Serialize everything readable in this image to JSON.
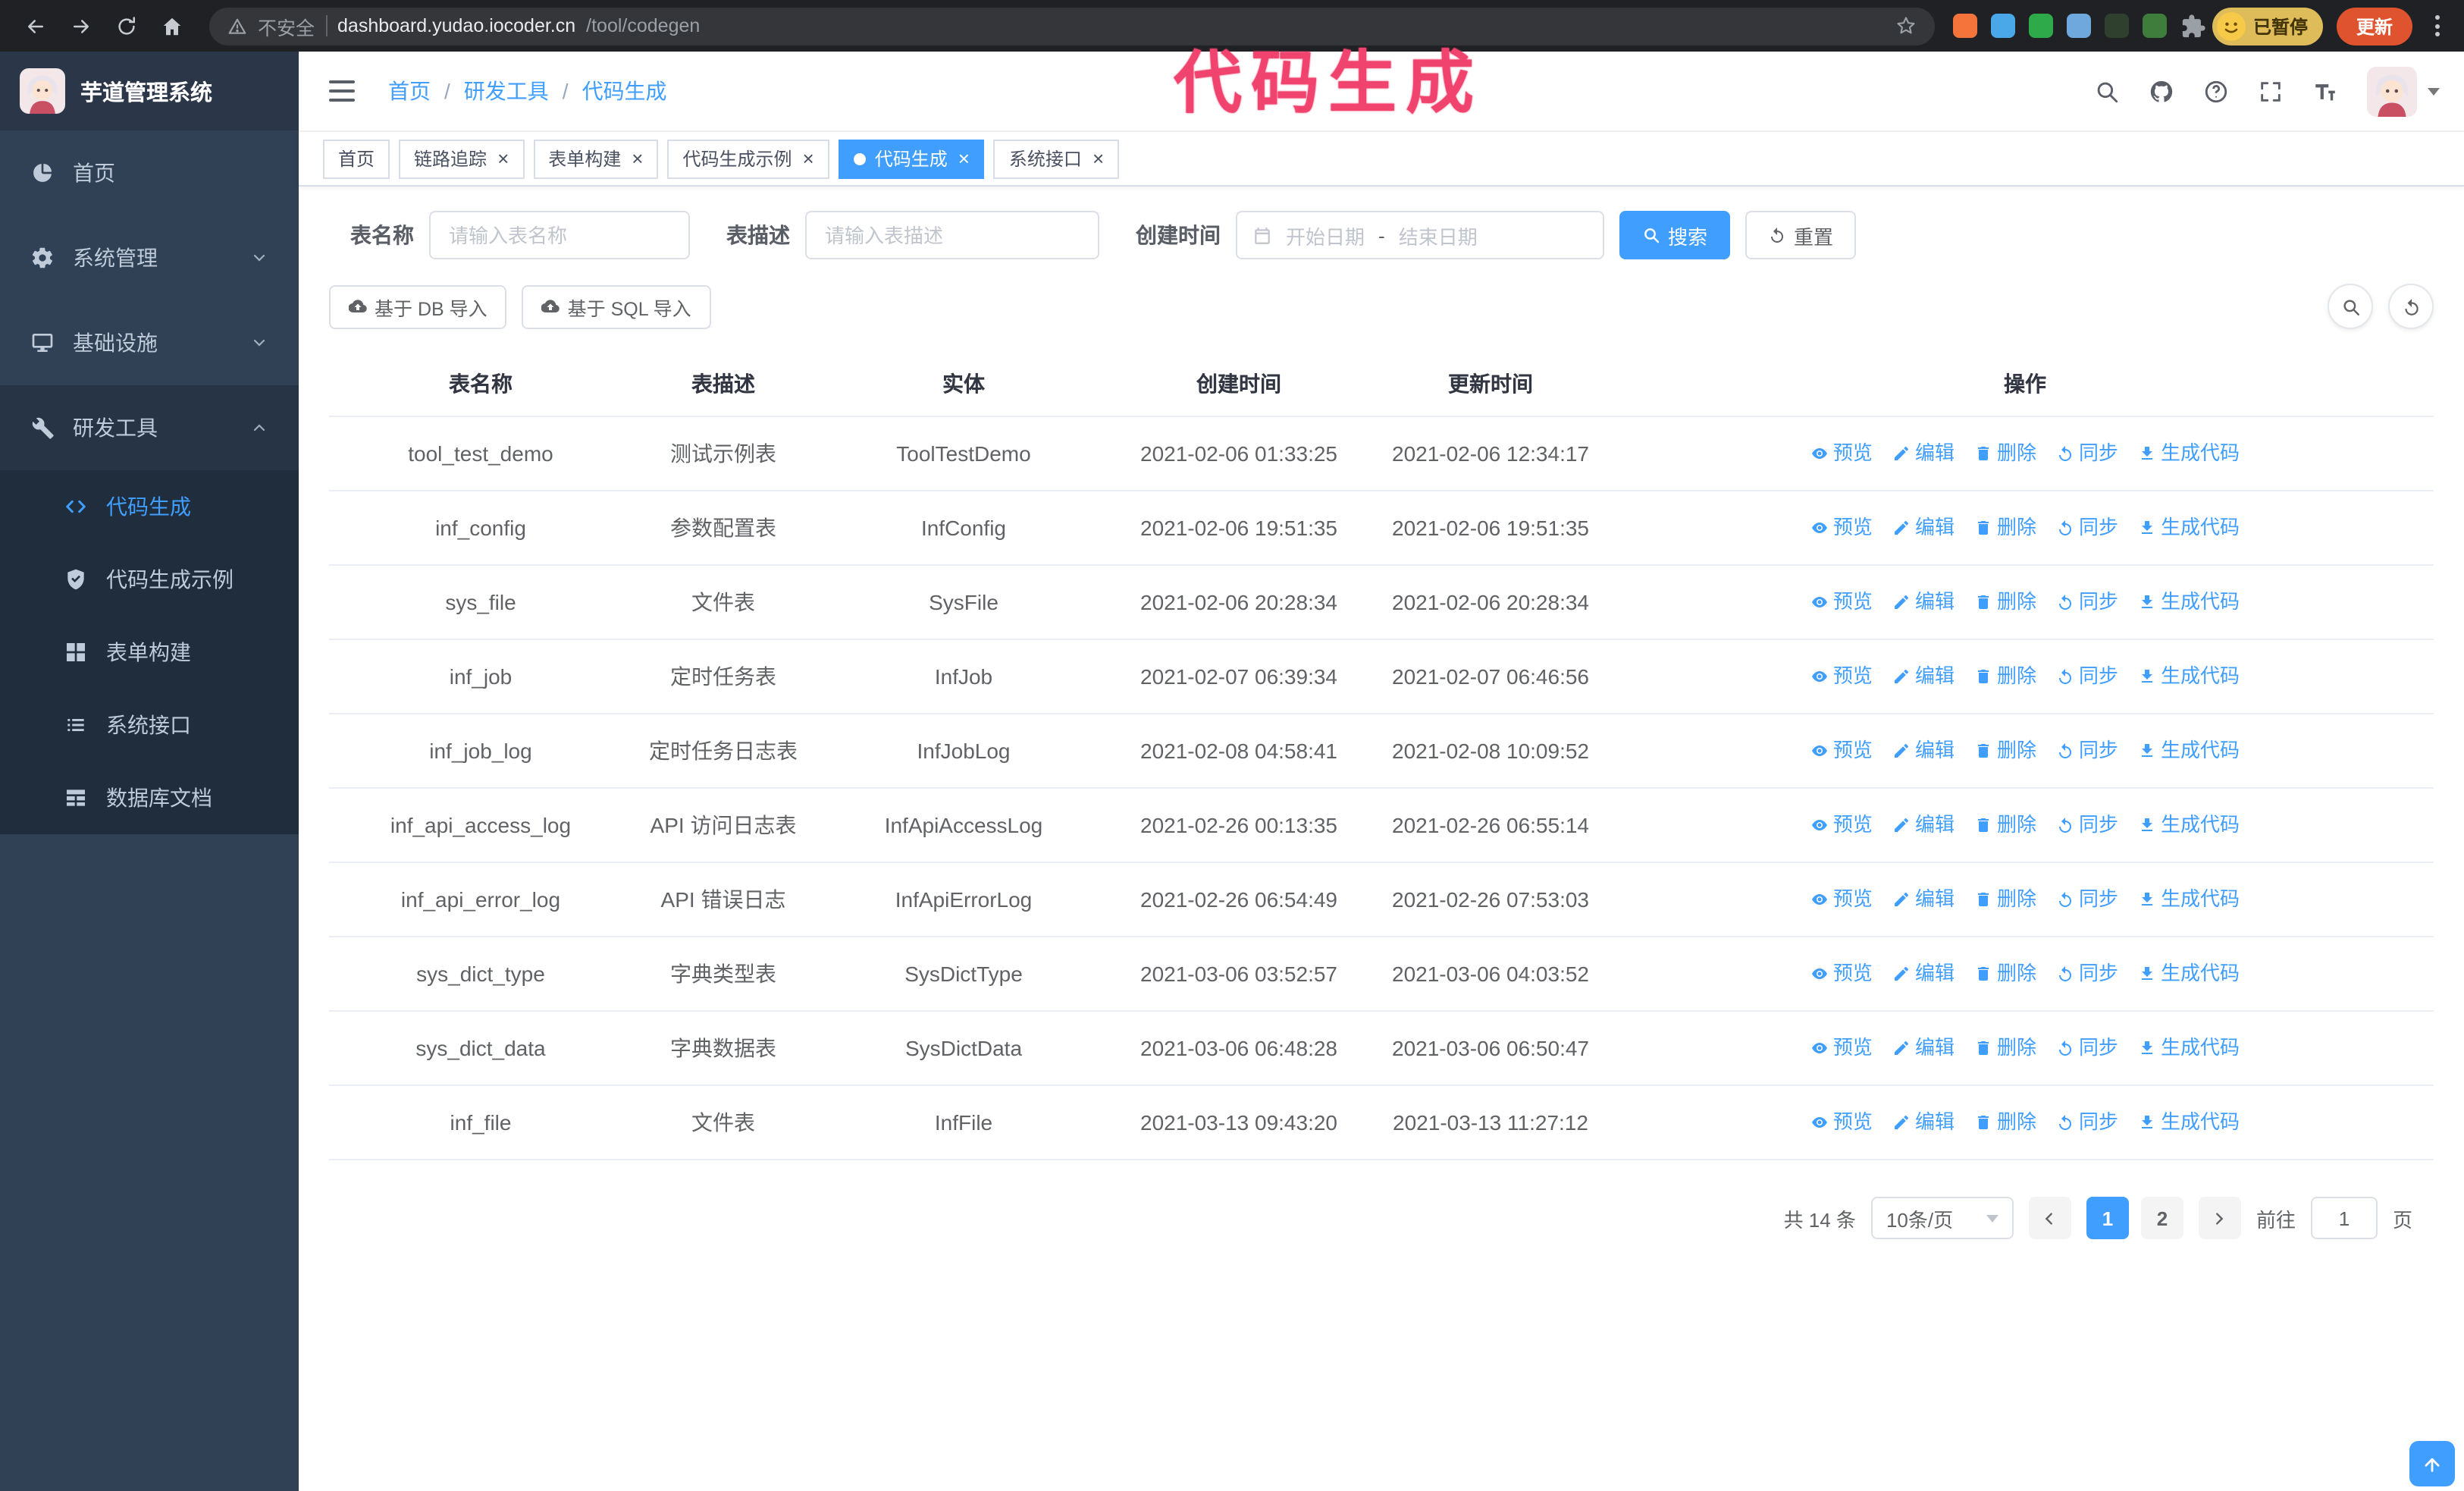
{
  "colors": {
    "primary": "#409eff",
    "annotation_pink": "#f0436e",
    "chrome_bg": "#202124",
    "sidebar_bg": "#304156",
    "submenu_bg": "#1f2d3d",
    "update_button_bg": "#e0532f"
  },
  "browser": {
    "security_label": "不安全",
    "url_host": "dashboard.yudao.iocoder.cn",
    "url_path": "/tool/codegen",
    "paused_badge": "已暂停",
    "update_button": "更新",
    "extensions": [
      {
        "icon": "orange-extension-icon",
        "color": "#f4743b"
      },
      {
        "icon": "blue-droplet-extension-icon",
        "color": "#4aa8e8"
      },
      {
        "icon": "green-circle-extension-icon",
        "color": "#2faa4a"
      },
      {
        "icon": "people-extension-icon",
        "color": "#6fa8dc"
      },
      {
        "icon": "dark-leaf-extension-icon",
        "color": "#30402f"
      },
      {
        "icon": "green-plant-extension-icon",
        "color": "#3e7d3b"
      },
      {
        "icon": "puzzle-extension-icon",
        "color": "#9aa0a6"
      }
    ]
  },
  "annotation": {
    "text": "代码生成"
  },
  "sidebar": {
    "logo_title": "芋道管理系统",
    "items": [
      {
        "key": "home",
        "label": "首页",
        "icon": "dashboard-icon",
        "expandable": false,
        "state": "none"
      },
      {
        "key": "system",
        "label": "系统管理",
        "icon": "gear-icon",
        "expandable": true,
        "state": "collapsed"
      },
      {
        "key": "infra",
        "label": "基础设施",
        "icon": "infra-icon",
        "expandable": true,
        "state": "collapsed"
      },
      {
        "key": "devtools",
        "label": "研发工具",
        "icon": "tools-icon",
        "expandable": true,
        "state": "expanded"
      }
    ],
    "submenu": [
      {
        "key": "codegen",
        "label": "代码生成",
        "icon": "code-icon",
        "active": true
      },
      {
        "key": "codegen-example",
        "label": "代码生成示例",
        "icon": "example-icon",
        "active": false
      },
      {
        "key": "form-builder",
        "label": "表单构建",
        "icon": "form-icon",
        "active": false
      },
      {
        "key": "system-api",
        "label": "系统接口",
        "icon": "api-icon",
        "active": false
      },
      {
        "key": "db-doc",
        "label": "数据库文档",
        "icon": "db-doc-icon",
        "active": false
      }
    ]
  },
  "navbar": {
    "breadcrumb": [
      "首页",
      "研发工具",
      "代码生成"
    ]
  },
  "tabs": [
    {
      "key": "home",
      "label": "首页",
      "closable": false,
      "active": false
    },
    {
      "key": "tracer",
      "label": "链路追踪",
      "closable": true,
      "active": false
    },
    {
      "key": "form-builder",
      "label": "表单构建",
      "closable": true,
      "active": false
    },
    {
      "key": "codegen-example",
      "label": "代码生成示例",
      "closable": true,
      "active": false
    },
    {
      "key": "codegen",
      "label": "代码生成",
      "closable": true,
      "active": true
    },
    {
      "key": "system-api",
      "label": "系统接口",
      "closable": true,
      "active": false
    }
  ],
  "filters": {
    "table_name_label": "表名称",
    "table_name_placeholder": "请输入表名称",
    "table_desc_label": "表描述",
    "table_desc_placeholder": "请输入表描述",
    "create_time_label": "创建时间",
    "date_start_placeholder": "开始日期",
    "date_separator": "-",
    "date_end_placeholder": "结束日期",
    "search_button": "搜索",
    "reset_button": "重置"
  },
  "toolbar": {
    "import_db_button": "基于 DB 导入",
    "import_sql_button": "基于 SQL 导入"
  },
  "table": {
    "columns": [
      "表名称",
      "表描述",
      "实体",
      "创建时间",
      "更新时间",
      "操作"
    ],
    "actions": [
      {
        "key": "preview",
        "label": "预览",
        "icon": "eye-icon"
      },
      {
        "key": "edit",
        "label": "编辑",
        "icon": "edit-icon"
      },
      {
        "key": "delete",
        "label": "删除",
        "icon": "delete-icon"
      },
      {
        "key": "sync",
        "label": "同步",
        "icon": "sync-icon"
      },
      {
        "key": "generate",
        "label": "生成代码",
        "icon": "download-icon"
      }
    ],
    "rows": [
      {
        "name": "tool_test_demo",
        "desc": "测试示例表",
        "entity": "ToolTestDemo",
        "created": "2021-02-06 01:33:25",
        "updated": "2021-02-06 12:34:17"
      },
      {
        "name": "inf_config",
        "desc": "参数配置表",
        "entity": "InfConfig",
        "created": "2021-02-06 19:51:35",
        "updated": "2021-02-06 19:51:35"
      },
      {
        "name": "sys_file",
        "desc": "文件表",
        "entity": "SysFile",
        "created": "2021-02-06 20:28:34",
        "updated": "2021-02-06 20:28:34"
      },
      {
        "name": "inf_job",
        "desc": "定时任务表",
        "entity": "InfJob",
        "created": "2021-02-07 06:39:34",
        "updated": "2021-02-07 06:46:56"
      },
      {
        "name": "inf_job_log",
        "desc": "定时任务日志表",
        "entity": "InfJobLog",
        "created": "2021-02-08 04:58:41",
        "updated": "2021-02-08 10:09:52"
      },
      {
        "name": "inf_api_access_log",
        "desc": "API 访问日志表",
        "entity": "InfApiAccessLog",
        "created": "2021-02-26 00:13:35",
        "updated": "2021-02-26 06:55:14"
      },
      {
        "name": "inf_api_error_log",
        "desc": "API 错误日志",
        "entity": "InfApiErrorLog",
        "created": "2021-02-26 06:54:49",
        "updated": "2021-02-26 07:53:03"
      },
      {
        "name": "sys_dict_type",
        "desc": "字典类型表",
        "entity": "SysDictType",
        "created": "2021-03-06 03:52:57",
        "updated": "2021-03-06 04:03:52"
      },
      {
        "name": "sys_dict_data",
        "desc": "字典数据表",
        "entity": "SysDictData",
        "created": "2021-03-06 06:48:28",
        "updated": "2021-03-06 06:50:47"
      },
      {
        "name": "inf_file",
        "desc": "文件表",
        "entity": "InfFile",
        "created": "2021-03-13 09:43:20",
        "updated": "2021-03-13 11:27:12"
      }
    ]
  },
  "pagination": {
    "total_text": "共 14 条",
    "page_size": "10条/页",
    "pages": [
      "1",
      "2"
    ],
    "active_page": "1",
    "goto_label": "前往",
    "goto_value": "1",
    "goto_suffix": "页"
  }
}
